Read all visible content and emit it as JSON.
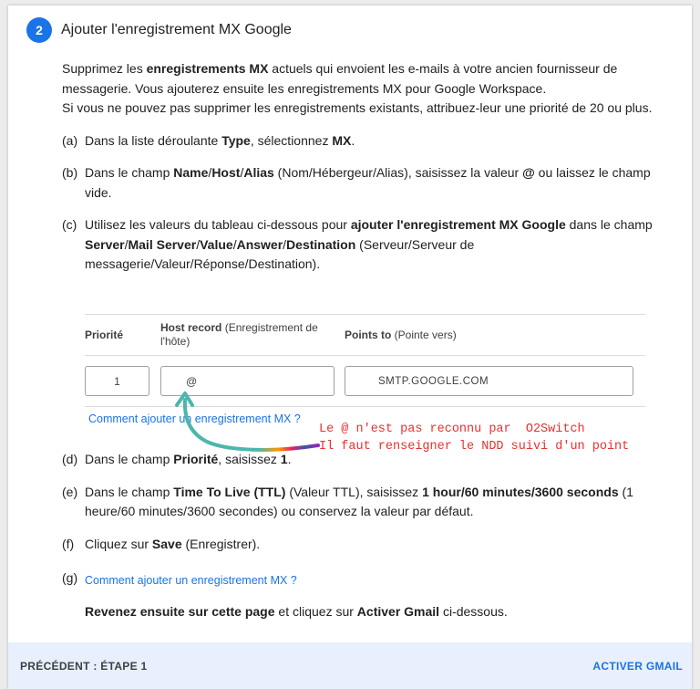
{
  "header": {
    "step_number": "2",
    "title": "Ajouter l'enregistrement MX Google"
  },
  "intro": {
    "line1": {
      "a": "Supprimez les ",
      "b": "enregistrements MX",
      "c": " actuels qui envoient les e-mails à votre ancien fournisseur de messagerie. Vous ajouterez ensuite les enregistrements MX pour Google Workspace."
    },
    "line2": "Si vous ne pouvez pas supprimer les enregistrements existants, attribuez-leur une priorité de 20 ou plus."
  },
  "steps": {
    "a": {
      "label": "(a)",
      "t1": "Dans la liste déroulante ",
      "b1": "Type",
      "t2": ", sélectionnez ",
      "b2": "MX",
      "t3": "."
    },
    "b": {
      "label": "(b)",
      "t1": "Dans le champ ",
      "b1": "Name",
      "s1": "/",
      "b2": "Host",
      "s2": "/",
      "b3": "Alias",
      "t2": " (Nom/Hébergeur/Alias), saisissez la valeur ",
      "b4": "@",
      "t3": " ou laissez le champ vide."
    },
    "c": {
      "label": "(c)",
      "t1": "Utilisez les valeurs du tableau ci-dessous pour ",
      "b1": "ajouter l'enregistrement MX Google",
      "t2": " dans le champ ",
      "b2": "Server",
      "s1": "/",
      "b3": "Mail Server",
      "s2": "/",
      "b4": "Value",
      "s3": "/",
      "b5": "Answer",
      "s4": "/",
      "b6": "Destination",
      "t3": " (Serveur/Serveur de messagerie/Valeur/Réponse/Destination)."
    },
    "d": {
      "label": "(d)",
      "t1": "Dans le champ ",
      "b1": "Priorité",
      "t2": ", saisissez ",
      "b2": "1",
      "t3": "."
    },
    "e": {
      "label": "(e)",
      "t1": "Dans le champ ",
      "b1": "Time To Live (TTL)",
      "t2": " (Valeur TTL), saisissez ",
      "b2": "1 hour/60 minutes/3600 seconds",
      "t3": " (1 heure/60 minutes/3600 secondes) ou conservez la valeur par défaut."
    },
    "f": {
      "label": "(f)",
      "t1": "Cliquez sur ",
      "b1": "Save",
      "t2": " (Enregistrer)."
    },
    "g": {
      "label": "(g)",
      "link": "Comment ajouter un enregistrement MX ?",
      "b1": "Revenez ensuite sur cette page",
      "t1": " et cliquez sur ",
      "b2": "Activer Gmail",
      "t2": " ci-dessous."
    }
  },
  "table": {
    "col1": "Priorité",
    "col2_bold": "Host record",
    "col2_rest": " (Enregistrement de l'hôte)",
    "col3_bold": "Points to",
    "col3_rest": " (Pointe vers)",
    "priority_value": "1",
    "host_value": "@",
    "points_to_value": "SMTP.GOOGLE.COM"
  },
  "help_link": "Comment ajouter un enregistrement MX ?",
  "annotation": {
    "line1": "Le @ n'est pas reconnu par  O2Switch",
    "line2": "Il faut renseigner le NDD suivi d'un point"
  },
  "footer": {
    "prev_label": "PRÉCÉDENT : ÉTAPE 1",
    "next_label": "ACTIVER GMAIL"
  },
  "colors": {
    "accent": "#1a73e8",
    "annotation": "#e8312f",
    "footer_bg": "#e8f0fe"
  }
}
